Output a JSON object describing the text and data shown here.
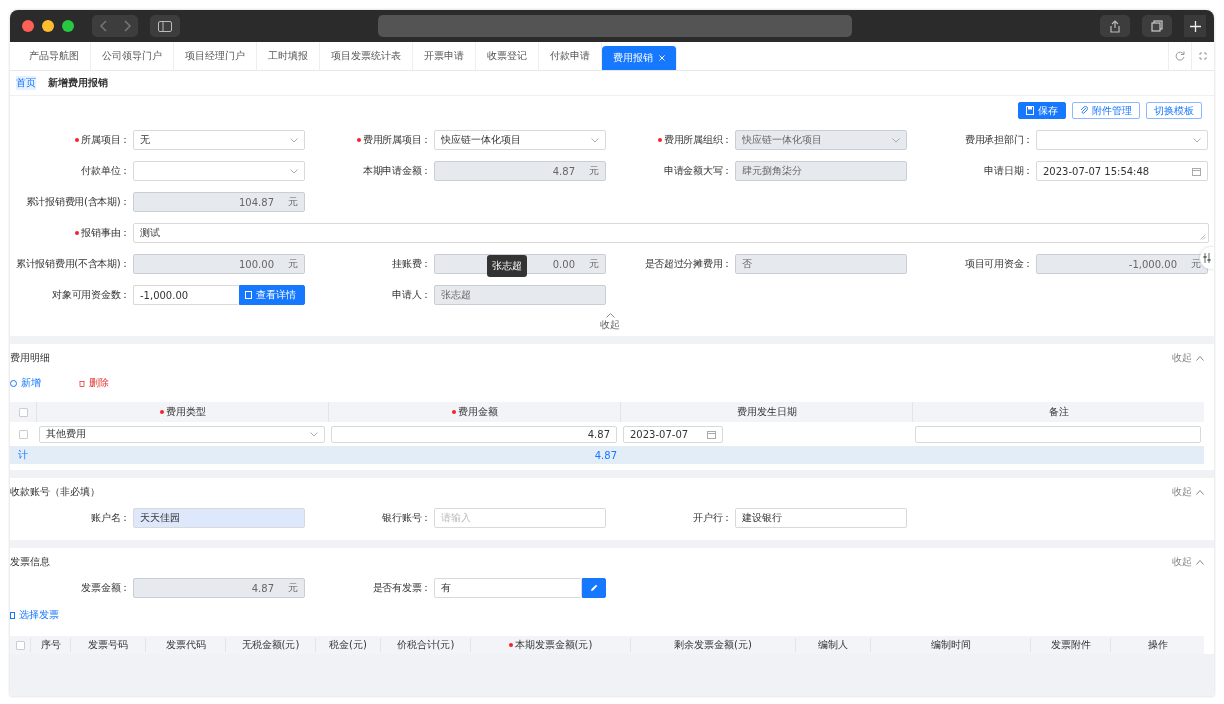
{
  "tabs": [
    {
      "label": "产品导航图",
      "selected": false
    },
    {
      "label": "公司领导门户",
      "selected": false
    },
    {
      "label": "项目经理门户",
      "selected": false
    },
    {
      "label": "工时填报",
      "selected": false
    },
    {
      "label": "项目发票统计表",
      "selected": false
    },
    {
      "label": "开票申请",
      "selected": false
    },
    {
      "label": "收票登记",
      "selected": false
    },
    {
      "label": "付款申请",
      "selected": false
    },
    {
      "label": "费用报销",
      "selected": true
    }
  ],
  "breadcrumb": {
    "home": "首页",
    "current": "新增费用报销"
  },
  "actions": [
    {
      "label": "保存",
      "kind": "primary"
    },
    {
      "label": "附件管理",
      "kind": "outline"
    },
    {
      "label": "切换模板",
      "kind": "outline"
    }
  ],
  "form": {
    "rows": [
      [
        {
          "label": "所属项目：",
          "required": true,
          "kind": "select",
          "value": "无",
          "readonly": false
        },
        {
          "label": "费用所属项目：",
          "required": true,
          "kind": "select",
          "value": "快应链一体化项目",
          "readonly": false
        },
        {
          "label": "费用所属组织：",
          "required": true,
          "kind": "select",
          "value": "快应链一体化项目",
          "readonly": true
        },
        {
          "label": "费用承担部门：",
          "required": false,
          "kind": "select",
          "readonly": false
        }
      ],
      [
        {
          "label": "付款单位：",
          "required": false,
          "kind": "select",
          "readonly": false
        },
        {
          "label": "本期申请金额：",
          "required": false,
          "kind": "amount",
          "value": "4.87",
          "unit": "元",
          "readonly": true
        },
        {
          "label": "申请金额大写：",
          "required": false,
          "kind": "text",
          "value": "肆元捌角柒分",
          "readonly": true
        },
        {
          "label": "申请日期：",
          "required": false,
          "kind": "date",
          "value": "2023-07-07 15:54:48",
          "readonly": false
        }
      ],
      [
        {
          "label": "累计报销费用(含本期)：",
          "required": false,
          "kind": "amount",
          "value": "104.87",
          "unit": "元",
          "readonly": true
        }
      ],
      [
        {
          "label": "报销事由：",
          "required": true,
          "kind": "textarea",
          "value": "测试",
          "readonly": false
        }
      ],
      [
        {
          "label": "累计报销费用(不含本期)：",
          "required": false,
          "kind": "amount",
          "value": "100.00",
          "unit": "元",
          "readonly": true
        },
        {
          "label": "挂账费：",
          "required": false,
          "kind": "amount",
          "value": "0.00",
          "unit": "元",
          "readonly": true
        },
        {
          "label": "是否超过分摊费用：",
          "required": false,
          "kind": "text",
          "value": "否",
          "readonly": true
        },
        {
          "label": "项目可用资金：",
          "required": false,
          "kind": "amount",
          "value": "-1,000.00",
          "unit": "元",
          "readonly": true
        }
      ],
      [
        {
          "label": "对象可用资金数：",
          "required": false,
          "kind": "action",
          "value": "-1,000.00",
          "button": "查看详情",
          "readonly": false
        },
        {
          "label": "申请人：",
          "required": false,
          "kind": "text",
          "value": "张志超",
          "readonly": true,
          "tooltip": "张志超"
        }
      ]
    ],
    "toggle": "收起"
  },
  "details": {
    "title": "费用明细",
    "toggle": "收起",
    "add": "新增",
    "delete": "删除",
    "select_all_checked": false,
    "columns": [
      {
        "label": "费用类型",
        "required": true
      },
      {
        "label": "费用金额",
        "required": true
      },
      {
        "label": "费用发生日期",
        "required": false
      },
      {
        "label": "备注",
        "required": false
      }
    ],
    "rows": [
      {
        "checked": false,
        "type": "其他费用",
        "amount": "4.87",
        "date": "2023-07-07"
      }
    ],
    "total": {
      "label": "计",
      "amount": "4.87"
    }
  },
  "account": {
    "title": "收款账号（非必填）",
    "toggle": "收起",
    "fields": [
      {
        "label": "账户名：",
        "required": false,
        "kind": "text",
        "value": "天天佳园",
        "readonly": false,
        "autofilled": true
      },
      {
        "label": "银行账号：",
        "required": false,
        "kind": "text",
        "placeholder": "请输入",
        "readonly": false,
        "autofilled": false
      },
      {
        "label": "开户行：",
        "required": false,
        "kind": "text",
        "value": "建设银行",
        "readonly": false,
        "autofilled": false
      }
    ]
  },
  "invoice": {
    "title": "发票信息",
    "toggle": "收起",
    "fields": [
      {
        "label": "发票金额：",
        "required": false,
        "kind": "amount",
        "value": "4.87",
        "unit": "元",
        "readonly": true
      },
      {
        "label": "是否有发票：",
        "required": false,
        "kind": "edit",
        "value": "有",
        "readonly": false
      }
    ],
    "select_link": "选择发票",
    "select_all_checked": false,
    "columns": [
      {
        "label": "序号",
        "required": false
      },
      {
        "label": "发票号码",
        "required": false
      },
      {
        "label": "发票代码",
        "required": false
      },
      {
        "label": "无税金额(元)",
        "required": false
      },
      {
        "label": "税金(元)",
        "required": false
      },
      {
        "label": "价税合计(元)",
        "required": false
      },
      {
        "label": "本期发票金额(元)",
        "required": true
      },
      {
        "label": "剩余发票金额(元)",
        "required": false
      },
      {
        "label": "编制人",
        "required": false
      },
      {
        "label": "编制时间",
        "required": false
      },
      {
        "label": "发票附件",
        "required": false
      },
      {
        "label": "操作",
        "required": false
      }
    ]
  }
}
